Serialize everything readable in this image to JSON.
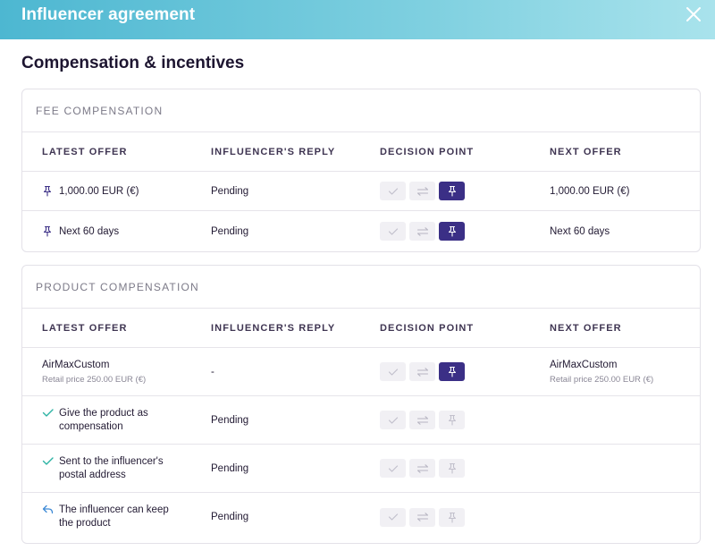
{
  "header": {
    "title": "Influencer agreement"
  },
  "page": {
    "title": "Compensation & incentives"
  },
  "columns": {
    "latest_offer": "LATEST OFFER",
    "influencer_reply": "INFLUENCER'S REPLY",
    "decision_point": "DECISION POINT",
    "next_offer": "NEXT OFFER"
  },
  "fee": {
    "title": "FEE COMPENSATION",
    "rows": [
      {
        "icon": "pin-icon",
        "latest": "1,000.00 EUR (€)",
        "reply": "Pending",
        "next": "1,000.00 EUR (€)",
        "decision": "pin"
      },
      {
        "icon": "pin-icon",
        "latest": "Next 60 days",
        "reply": "Pending",
        "next": "Next 60 days",
        "decision": "pin"
      }
    ]
  },
  "product": {
    "title": "PRODUCT COMPENSATION",
    "rows": [
      {
        "latest": "AirMaxCustom",
        "latest_sub": "Retail price 250.00 EUR (€)",
        "reply": "-",
        "next": "AirMaxCustom",
        "next_sub": "Retail price 250.00 EUR (€)",
        "decision": "pin"
      },
      {
        "icon": "check-icon",
        "latest": "Give the product as compensation",
        "reply": "Pending",
        "decision": "none"
      },
      {
        "icon": "check-icon",
        "latest": "Sent to the influencer's postal address",
        "reply": "Pending",
        "decision": "none"
      },
      {
        "icon": "reply-icon",
        "latest": "The influencer can keep the product",
        "reply": "Pending",
        "decision": "none"
      }
    ]
  },
  "colors": {
    "accent": "#3b2f86",
    "check": "#2bb3a3",
    "reply": "#3e8ad6",
    "header_from": "#4db7d1",
    "header_to": "#a9e3ec"
  }
}
